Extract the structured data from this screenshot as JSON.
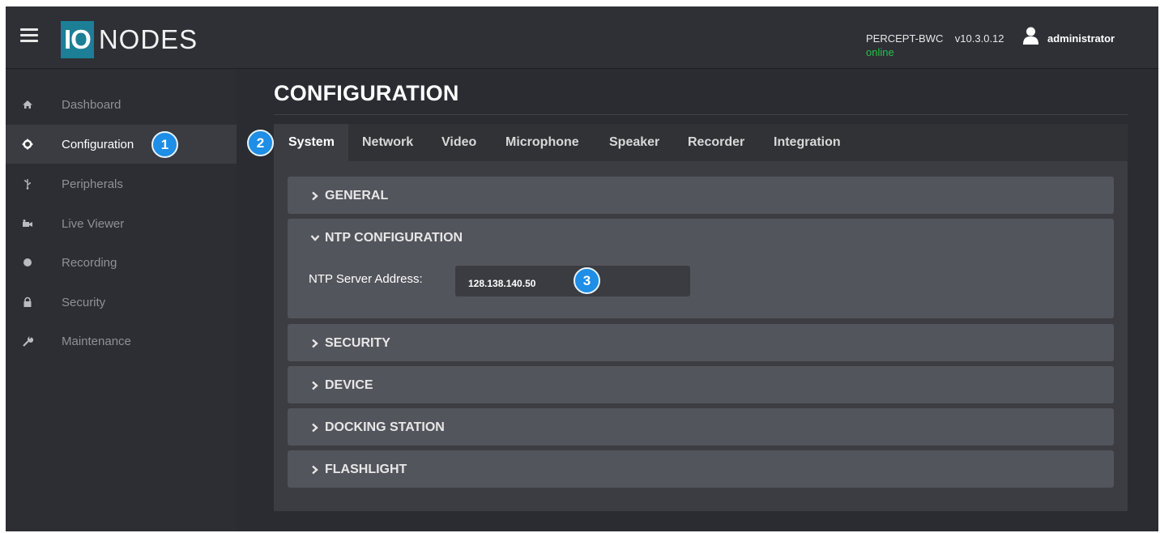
{
  "header": {
    "logo_mark": "IO",
    "logo_text": "NODES",
    "device_name": "PERCEPT-BWC",
    "version": "v10.3.0.12",
    "status": "online",
    "username": "administrator"
  },
  "sidebar": {
    "items": [
      {
        "label": "Dashboard",
        "icon": "home-icon"
      },
      {
        "label": "Configuration",
        "icon": "gear-icon",
        "active": true
      },
      {
        "label": "Peripherals",
        "icon": "usb-icon"
      },
      {
        "label": "Live Viewer",
        "icon": "video-camera-icon"
      },
      {
        "label": "Recording",
        "icon": "record-dot-icon"
      },
      {
        "label": "Security",
        "icon": "lock-icon"
      },
      {
        "label": "Maintenance",
        "icon": "wrench-icon"
      }
    ]
  },
  "callouts": [
    "1",
    "2",
    "3"
  ],
  "main": {
    "title": "CONFIGURATION",
    "tabs": [
      {
        "label": "System",
        "active": true
      },
      {
        "label": "Network"
      },
      {
        "label": "Video"
      },
      {
        "label": "Microphone"
      },
      {
        "label": "Speaker"
      },
      {
        "label": "Recorder"
      },
      {
        "label": "Integration"
      }
    ],
    "sections": [
      {
        "label": "GENERAL",
        "expanded": false
      },
      {
        "label": "NTP CONFIGURATION",
        "expanded": true
      },
      {
        "label": "SECURITY",
        "expanded": false
      },
      {
        "label": "DEVICE",
        "expanded": false
      },
      {
        "label": "DOCKING STATION",
        "expanded": false
      },
      {
        "label": "FLASHLIGHT",
        "expanded": false
      }
    ],
    "ntp": {
      "label": "NTP Server Address:",
      "value": "128.138.140.50"
    }
  },
  "colors": {
    "accent": "#1c7f96",
    "badge": "#1e8ee6",
    "online": "#27c04b"
  }
}
